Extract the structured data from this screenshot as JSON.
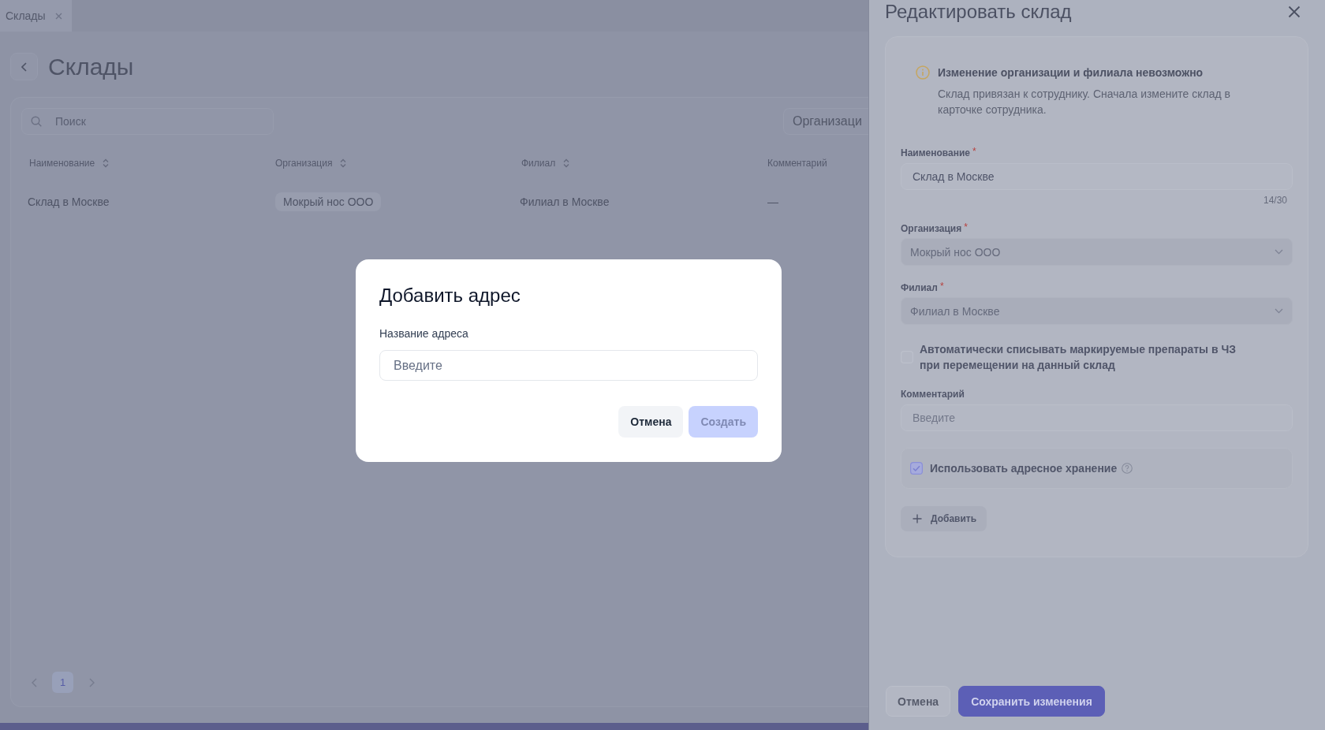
{
  "tabs": [
    {
      "label": "Склады",
      "selected": true
    }
  ],
  "page": {
    "title": "Склады"
  },
  "table": {
    "search": {
      "placeholder": "Поиск"
    },
    "filter": {
      "label": "Организаци"
    },
    "columns": [
      {
        "label": "Наименование",
        "sortable": true
      },
      {
        "label": "Организация",
        "sortable": true
      },
      {
        "label": "Филиал",
        "sortable": true
      },
      {
        "label": "Комментарий",
        "sortable": false
      }
    ],
    "rows": [
      {
        "name": "Склад в Москве",
        "organization": "Мокрый нос ООО",
        "branch": "Филиал в Москве",
        "comment": "—"
      }
    ]
  },
  "pagination": {
    "pages": [
      {
        "label": "1",
        "selected": true
      }
    ]
  },
  "drawer": {
    "title": "Редактировать склад",
    "notice": {
      "title": "Изменение организации и филиала невозможно",
      "text": "Склад привязан к сотруднику. Сначала измените склад в карточке сотрудника."
    },
    "form": [
      {
        "kind": "input",
        "label": "Наименование",
        "mark": "*",
        "value": "Склад в Москве",
        "counter": "14/30"
      },
      {
        "kind": "select",
        "label": "Организация",
        "mark": "*",
        "value": "Мокрый нос ООО",
        "disabled": true
      },
      {
        "kind": "select",
        "label": "Филиал",
        "mark": "*",
        "value": "Филиал в Москве",
        "disabled": true
      },
      {
        "kind": "checkbox",
        "label": "Автоматически списывать маркируемые препараты в ЧЗ при перемещении на данный склад",
        "checked": false
      },
      {
        "kind": "input",
        "label": "Комментарий",
        "placeholder": "Введите"
      },
      {
        "kind": "panel",
        "label": "Использовать адресное хранение",
        "checked": true
      }
    ],
    "add_button": {
      "label": "Добавить"
    },
    "buttons": [
      {
        "label": "Отмена",
        "kind": "secondary"
      },
      {
        "label": "Сохранить изменения",
        "kind": "primary"
      }
    ]
  },
  "dialog": {
    "title": "Добавить адрес",
    "field": {
      "label": "Название адреса",
      "placeholder": "Введите"
    },
    "buttons": [
      {
        "label": "Отмена",
        "kind": "secondary",
        "disabled": false
      },
      {
        "label": "Создать",
        "kind": "primary",
        "disabled": true
      }
    ]
  }
}
